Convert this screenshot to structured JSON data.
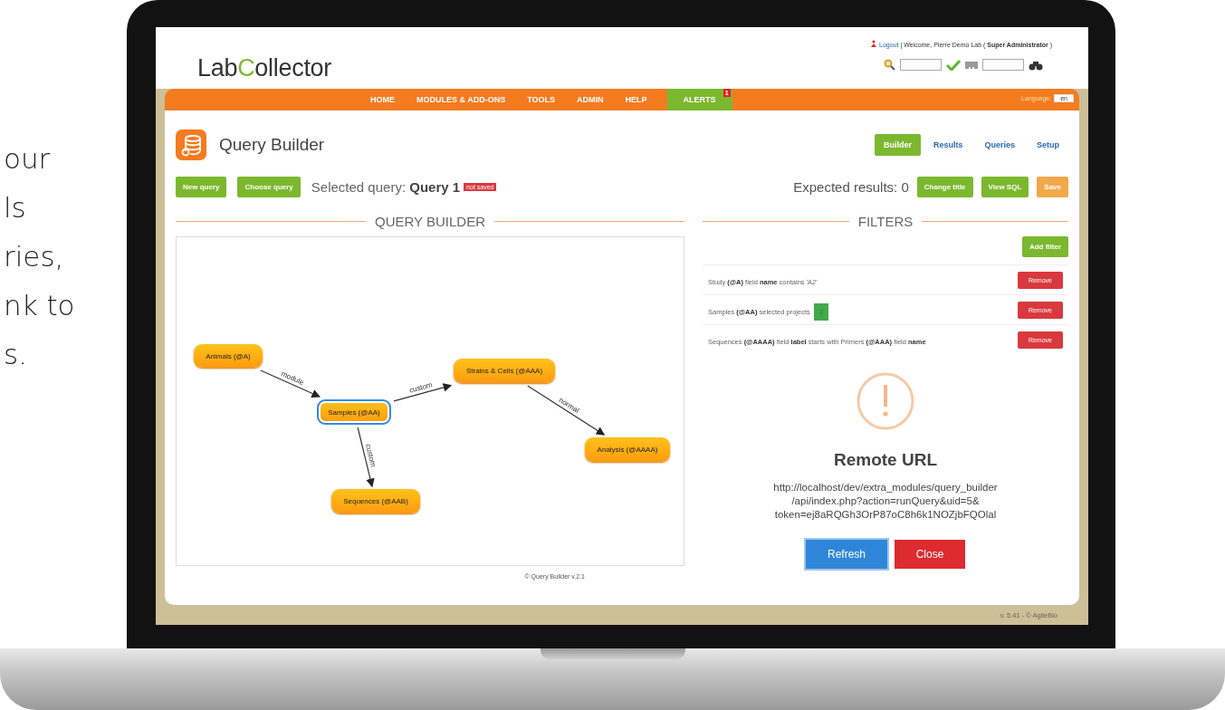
{
  "side_text": [
    "our",
    "ls",
    "ries,",
    "nk to",
    "s."
  ],
  "header": {
    "logo": [
      "Lab",
      "C",
      "ollector"
    ],
    "logout": "Logout",
    "welcome": "| Welcome, Pierre Demo Lab ( **Super Administrator** )"
  },
  "nav": [
    {
      "label": "HOME",
      "kind": "link"
    },
    {
      "label": "MODULES & ADD-ONS",
      "kind": "link"
    },
    {
      "label": "TOOLS",
      "kind": "link"
    },
    {
      "label": "ADMIN",
      "kind": "link"
    },
    {
      "label": "HELP",
      "kind": "link"
    },
    {
      "label": "ALERTS",
      "kind": "alert",
      "badge": "1"
    }
  ],
  "language": {
    "label": "Language:",
    "value": "en"
  },
  "page": {
    "title": "Query Builder"
  },
  "tabs": [
    {
      "label": "Builder",
      "selected": true
    },
    {
      "label": "Results",
      "selected": false
    },
    {
      "label": "Queries",
      "selected": false
    },
    {
      "label": "Setup",
      "selected": false
    }
  ],
  "left_toolbar": {
    "buttons": [
      "New query",
      "Choose query"
    ],
    "selected_label": "Selected query:",
    "query_name": "Query 1",
    "status": "not saved"
  },
  "right_toolbar": {
    "expected": "Expected results: 0",
    "buttons": [
      {
        "label": "Change title",
        "kind": "primary"
      },
      {
        "label": "View SQL",
        "kind": "primary"
      },
      {
        "label": "Save",
        "kind": "save"
      }
    ]
  },
  "builder": {
    "heading": "QUERY BUILDER",
    "nodes": [
      {
        "label": "Animals (@A)",
        "selected": false
      },
      {
        "label": "Samples (@AA)",
        "selected": true
      },
      {
        "label": "Strains & Cells (@AAA)",
        "selected": false
      },
      {
        "label": "Analysis (@AAAA)",
        "selected": false
      },
      {
        "label": "Sequences (@AAB)",
        "selected": false
      }
    ],
    "edges": [
      {
        "label": "module"
      },
      {
        "label": "custom"
      },
      {
        "label": "normal"
      },
      {
        "label": "custom"
      }
    ],
    "credit": "© Query Builder v.2.1"
  },
  "filters": {
    "heading": "FILTERS",
    "add": "Add filter",
    "rows": [
      {
        "text": "Study **(@A)** field **name** contains 'A2'",
        "remove": "Remove"
      },
      {
        "text": "Samples **(@AA)** selected projects",
        "badge": "3",
        "remove": "Remove"
      },
      {
        "text": "Sequences **(@AAAA)** field **label** starts with Primers **(@AAA)** field **name**",
        "remove": "Remove"
      }
    ]
  },
  "remote": {
    "title": "Remote URL",
    "url_lines": [
      "http://localhost/dev/extra_modules/query_builder",
      "/api/index.php?action=runQuery&uid=5&",
      "token=ej8aRQGh3OrP87oC8h6k1NOZjbFQOlal"
    ],
    "buttons": [
      {
        "label": "Refresh",
        "kind": "primary"
      },
      {
        "label": "Close",
        "kind": "danger"
      }
    ]
  },
  "version": "v. 5.41 - © AgileBio"
}
